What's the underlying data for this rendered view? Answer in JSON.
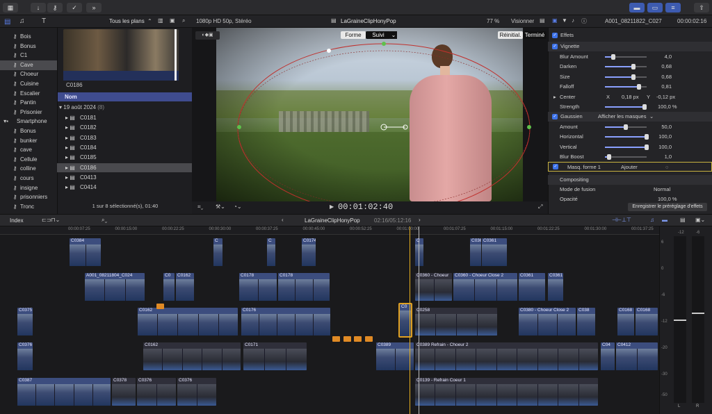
{
  "toolbar": {
    "right_icons": [
      "layout-icon",
      "layout2-icon",
      "settings-icon"
    ]
  },
  "browser": {
    "filter": "Tous les plans",
    "sort_label": "Nom",
    "date_group": "19 août 2024",
    "date_count": "(8)",
    "status": "1 sur 8 sélectionné(s), 01:40",
    "preview_clip": "C0186"
  },
  "sidebar": {
    "items": [
      {
        "label": "Bois"
      },
      {
        "label": "Bonus"
      },
      {
        "label": "C1"
      },
      {
        "label": "Cave"
      },
      {
        "label": "Choeur"
      },
      {
        "label": "Cuisine"
      },
      {
        "label": "Escalier"
      },
      {
        "label": "Pantin"
      },
      {
        "label": "Prisonier"
      },
      {
        "label": "Smartphone"
      },
      {
        "label": "Bonus"
      },
      {
        "label": "bunker"
      },
      {
        "label": "cave"
      },
      {
        "label": "Cellule"
      },
      {
        "label": "colline"
      },
      {
        "label": "cours"
      },
      {
        "label": "insigne"
      },
      {
        "label": "prisonniers"
      },
      {
        "label": "Tronc"
      }
    ]
  },
  "clips": {
    "rows": [
      "C0181",
      "C0182",
      "C0183",
      "C0184",
      "C0185",
      "C0186",
      "C0413",
      "C0414"
    ]
  },
  "viewer": {
    "format": "1080p HD 50p, Stéréo",
    "project": "LaGraineClipHonyPop",
    "zoom": "77 %",
    "view_label": "Visionner",
    "tab_forme": "Forme",
    "tab_suivi": "Suivi",
    "reset": "Réinitial.",
    "done": "Terminé",
    "timecode": "00:01:02:40"
  },
  "inspector": {
    "clip_name": "A001_08211822_C027",
    "duration": "00:00:02:16",
    "effects_label": "Effets",
    "vignette_label": "Vignette",
    "params": [
      {
        "label": "Blur Amount",
        "value": "4,0",
        "frac": 0.2
      },
      {
        "label": "Darken",
        "value": "0,68",
        "frac": 0.68
      },
      {
        "label": "Size",
        "value": "0,68",
        "frac": 0.68
      },
      {
        "label": "Falloff",
        "value": "0,81",
        "frac": 0.81
      }
    ],
    "center_label": "Center",
    "center_x_label": "X",
    "center_x": "0,18 px",
    "center_y_label": "Y",
    "center_y": "-0,12 px",
    "strength_label": "Strength",
    "strength_value": "100,0 %",
    "gaussien_label": "Gaussien",
    "mask_dropdown": "Afficher les masques",
    "gparams": [
      {
        "label": "Amount",
        "value": "50,0",
        "frac": 0.5
      },
      {
        "label": "Horizontal",
        "value": "100,0",
        "frac": 1.0
      },
      {
        "label": "Vertical",
        "value": "100,0",
        "frac": 1.0
      },
      {
        "label": "Blur Boost",
        "value": "1,0",
        "frac": 0.1
      }
    ],
    "mask_label": "Masq. forme 1",
    "mask_add": "Ajouter",
    "compositing": "Compositing",
    "blend_label": "Mode de fusion",
    "blend_value": "Normal",
    "opacity_label": "Opacité",
    "opacity_value": "100,0 %",
    "save_preset": "Enregistrer le préréglage d'effets"
  },
  "timeline": {
    "index": "Index",
    "project": "LaGraineClipHonyPop",
    "position": "02:16/05:12:16",
    "ruler": [
      "00:00:07:25",
      "00:00:15:00",
      "00:00:22:25",
      "00:00:30:00",
      "00:00:37:25",
      "00:00:45:00",
      "00:00:52:25",
      "00:01:00:00",
      "00:01:07:25",
      "00:01:15:00",
      "00:01:22:25",
      "00:01:30:00",
      "00:01:37:25"
    ]
  },
  "meters": {
    "scale": [
      "-12",
      "-6",
      "6",
      "0",
      "-6",
      "-12",
      "-20",
      "-30",
      "-50"
    ],
    "left": "L",
    "right": "R"
  },
  "track_clips": [
    {
      "label": "C0384"
    },
    {
      "label": "C"
    },
    {
      "label": "C"
    },
    {
      "label": "C0174"
    },
    {
      "label": "C"
    },
    {
      "label": "C0361"
    },
    {
      "label": "C0361"
    },
    {
      "label": "A001_08211804_C024"
    },
    {
      "label": "C0"
    },
    {
      "label": "C0162"
    },
    {
      "label": "C0178"
    },
    {
      "label": "C0178"
    },
    {
      "label": "C0360 - Choeur"
    },
    {
      "label": "C0360 - Choeur Close 2"
    },
    {
      "label": "C0361"
    },
    {
      "label": "C0361"
    },
    {
      "label": "C0375"
    },
    {
      "label": "C0162"
    },
    {
      "label": "C0176"
    },
    {
      "label": "C0"
    },
    {
      "label": "C0258"
    },
    {
      "label": "C0380 - Choeur Close 2"
    },
    {
      "label": "C038"
    },
    {
      "label": "C0168"
    },
    {
      "label": "C0168"
    },
    {
      "label": "C0376"
    },
    {
      "label": "C0162"
    },
    {
      "label": "C0171"
    },
    {
      "label": "C0389"
    },
    {
      "label": "C0389 Refrain - Choeur 2"
    },
    {
      "label": "C04"
    },
    {
      "label": "C0412"
    },
    {
      "label": "C0387"
    },
    {
      "label": "C0378"
    },
    {
      "label": "C0376"
    },
    {
      "label": "C0376"
    },
    {
      "label": "C0139 - Refrain Coeur 1"
    }
  ]
}
